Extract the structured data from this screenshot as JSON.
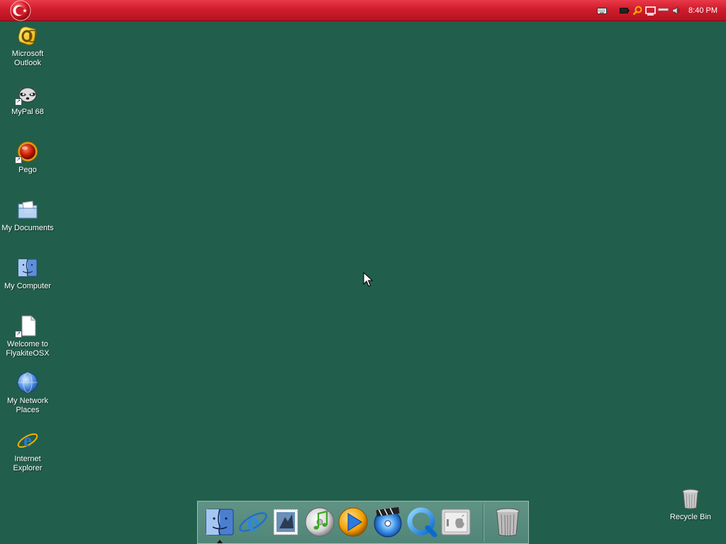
{
  "menubar": {
    "logo_icon": "turkish-flag-logo-icon",
    "clock": "8:40 PM",
    "tray_icons": [
      "keyboard-icon",
      "battery-icon",
      "search-icon",
      "display-icon",
      "minimize-bar-icon",
      "volume-icon"
    ]
  },
  "desktop_icons": [
    {
      "label": "Microsoft\nOutlook",
      "icon": "outlook-icon"
    },
    {
      "label": "MyPal 68",
      "icon": "mypal-raccoon-icon"
    },
    {
      "label": "Pego",
      "icon": "pego-icon"
    },
    {
      "label": "My Documents",
      "icon": "folder-icon"
    },
    {
      "label": "My Computer",
      "icon": "finder-computer-icon"
    },
    {
      "label": "Welcome to\nFlyakiteOSX",
      "icon": "document-icon"
    },
    {
      "label": "My Network\nPlaces",
      "icon": "network-globe-icon"
    },
    {
      "label": "Internet\nExplorer",
      "icon": "internet-explorer-icon"
    },
    {
      "label": "Recycle Bin",
      "icon": "trash-icon"
    }
  ],
  "dock": {
    "items": [
      "finder-icon",
      "internet-explorer-icon",
      "mail-stamp-icon",
      "itunes-icon",
      "media-player-icon",
      "dvd-player-icon",
      "quicktime-icon",
      "system-preferences-icon",
      "trash-icon"
    ]
  },
  "colors": {
    "desktop": "#215e4b",
    "menubar": "#cf1d2c",
    "label_text": "#ffffff"
  }
}
